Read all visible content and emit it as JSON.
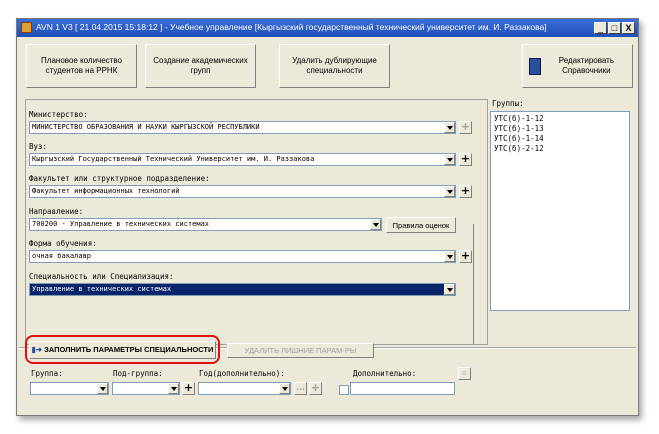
{
  "window": {
    "title": "AVN 1 V3 [ 21.04.2015 15:18:12 ] - Учебное управление  [Кыргызский государственный технический университет им. И. Раззакова]",
    "controls": [
      "_",
      "□",
      "X"
    ]
  },
  "toolbar": {
    "plan_label": "Плановое количество студентов на РРНК",
    "create_groups_label": "Создание академических групп",
    "delete_dup_label": "Удалить дублирующие специальности",
    "edit_refs_label": "Редактировать Справочники"
  },
  "form": {
    "ministry": {
      "label": "Министерство:",
      "value": "МИНИСТЕРСТВО ОБРАЗОВАНИЯ И НАУКИ КЫРГЫЗСКОЙ РЕСПУБЛИКИ"
    },
    "university": {
      "label": "Вуз:",
      "value": "Кыргызский Государственный Технический Университет им. И. Раззакова"
    },
    "faculty": {
      "label": "Факультет или структурное подразделение:",
      "value": "Факультет информационных технологий"
    },
    "direction": {
      "label": "Направление:",
      "value": "700200 - Управление в технических системах",
      "rules_button": "Правила оценок"
    },
    "study_form": {
      "label": "Форма обучения:",
      "value": "очная бакалавр"
    },
    "specialty": {
      "label": "Специальность или Специализация:",
      "value": "Управление в технических системах"
    }
  },
  "groups": {
    "label": "Группы:",
    "items": [
      "УТС(б)-1-12",
      "УТС(б)-1-13",
      "УТС(б)-1-14",
      "УТС(б)-2-12"
    ]
  },
  "actions": {
    "fill_params_label": "ЗАПОЛНИТЬ ПАРАМЕТРЫ СПЕЦИАЛЬНОСТИ",
    "delete_params_label": "УДАЛИТЬ ЛИШНИЕ ПАРАМ-РЫ"
  },
  "filters": {
    "group_label": "Группа:",
    "subgroup_label": "Под-группа:",
    "year_label": "Год(дополнительно):",
    "extra_label": "Дополнительно:",
    "ellipsis": "..."
  },
  "colors": {
    "selection": "#0a246a",
    "highlight": "#e01010",
    "titlebar": "#1f4fb8"
  }
}
